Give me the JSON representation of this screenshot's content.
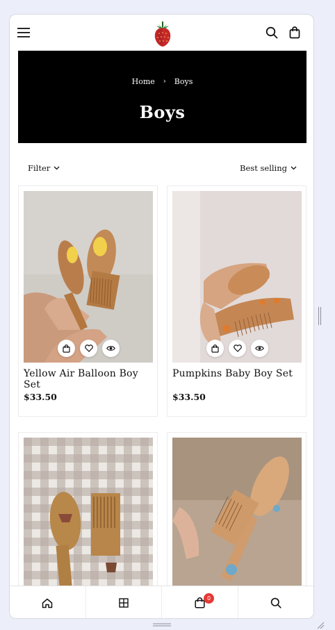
{
  "header": {
    "menu_icon": "hamburger-icon",
    "logo": "strawberry-logo",
    "search_icon": "search-icon",
    "cart_icon": "bag-icon"
  },
  "hero": {
    "breadcrumb_home": "Home",
    "breadcrumb_separator": "›",
    "breadcrumb_current": "Boys",
    "title": "Boys"
  },
  "toolbar": {
    "filter_label": "Filter",
    "sort_label": "Best selling"
  },
  "products": [
    {
      "title": "Yellow Air Balloon Boy Set",
      "price": "$33.50"
    },
    {
      "title": "Pumpkins Baby Boy Set",
      "price": "$33.50"
    },
    {
      "title": "",
      "price": ""
    },
    {
      "title": "",
      "price": ""
    }
  ],
  "bottom_nav": {
    "items": [
      "home-icon",
      "grid-icon",
      "bag-icon",
      "search-icon"
    ],
    "cart_count": "0"
  },
  "colors": {
    "hero_bg": "#000000",
    "page_bg": "#eceef9",
    "badge": "#e53935"
  }
}
